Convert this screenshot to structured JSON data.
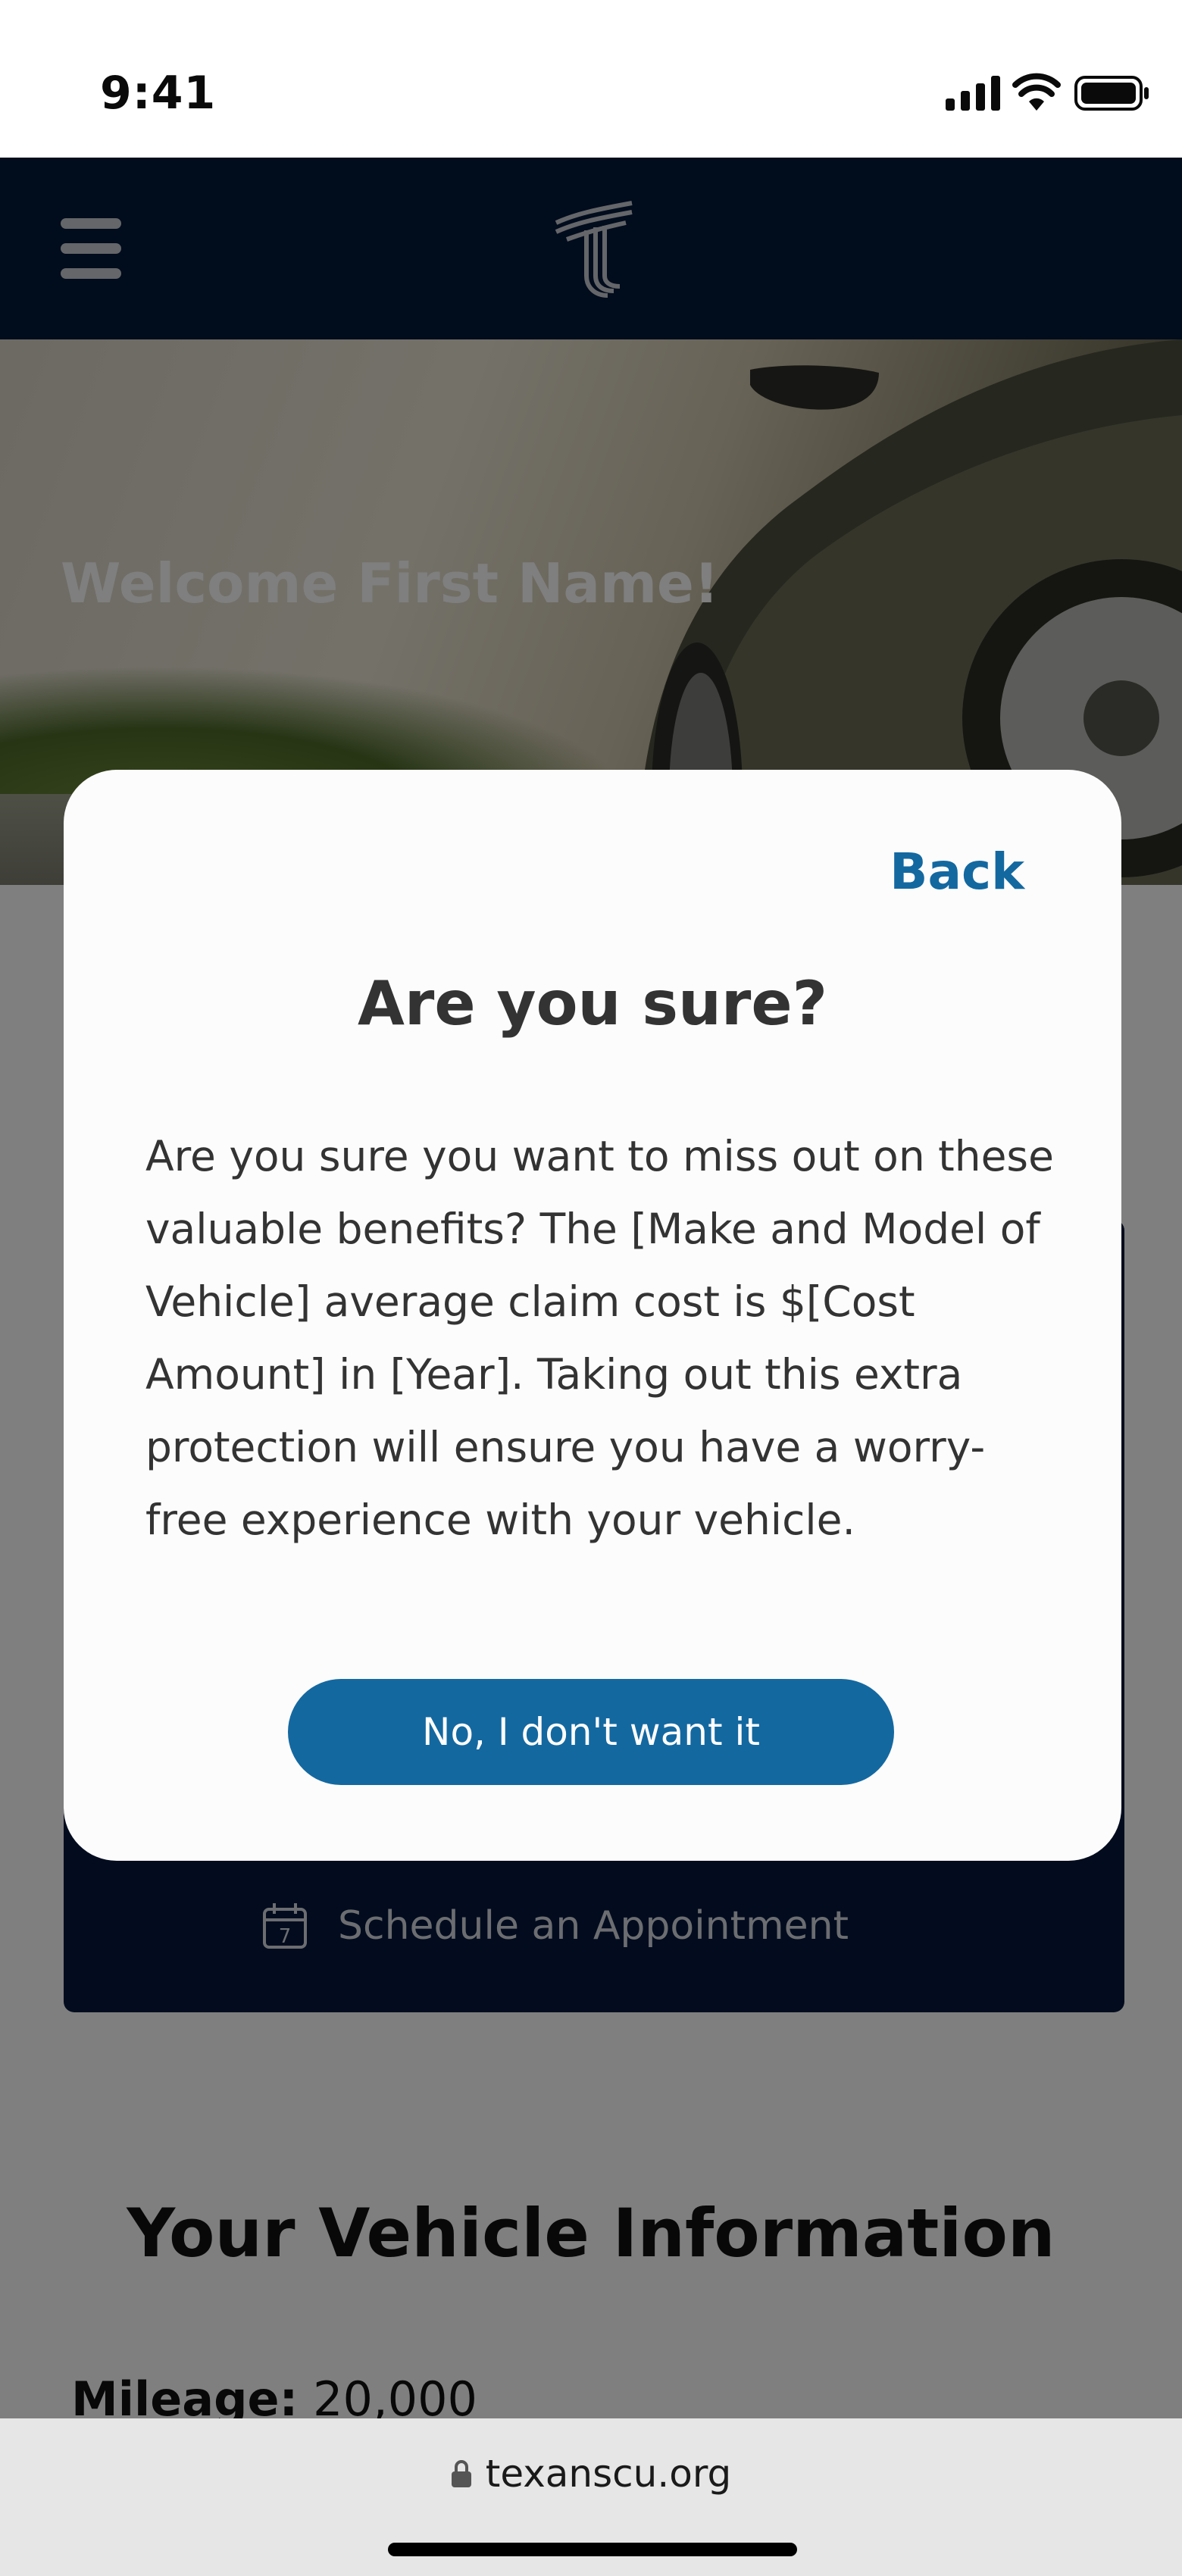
{
  "status_bar": {
    "time": "9:41",
    "signal_icon": "cellular-signal-icon",
    "wifi_icon": "wifi-icon",
    "battery_icon": "battery-icon"
  },
  "navbar": {
    "menu_icon": "hamburger-menu-icon",
    "logo_icon": "texans-cu-logo-icon",
    "background": "#03183a"
  },
  "hero": {
    "welcome_text": "Welcome First Name!"
  },
  "page": {
    "schedule_icon": "calendar-icon",
    "schedule_label": "Schedule an Appointment",
    "calendar_day": "7",
    "vehicle_section_title": "Your Vehicle Information",
    "mileage_label": "Mileage:",
    "mileage_value": "20,000"
  },
  "modal": {
    "back_label": "Back",
    "title": "Are you sure?",
    "body": "Are you sure you want to miss out on these valuable benefits? The [Make and Model of Vehicle] average claim cost is $[Cost Amount] in [Year]. Taking out this extra protection will ensure you have a worry-free experience with your vehicle.",
    "decline_button_label": "No, I don't want it",
    "accent_color": "#1468a0"
  },
  "browser": {
    "lock_icon": "lock-icon",
    "url": "texanscu.org"
  }
}
